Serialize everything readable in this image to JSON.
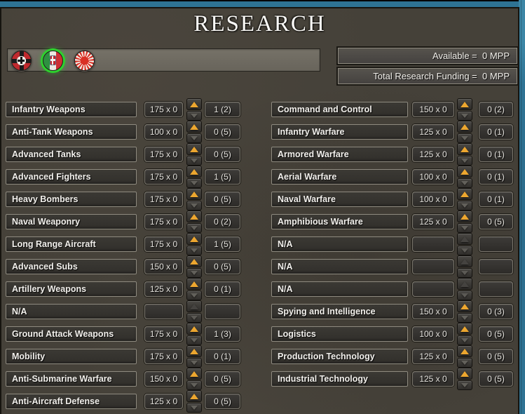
{
  "title": "RESEARCH",
  "colors": {
    "accent_orange": "#eca62f",
    "selected_green": "#2ed12e",
    "map_blue": "#2e7394",
    "panel_brown": "#454139"
  },
  "header": {
    "flags": [
      {
        "name": "germany",
        "selected": false
      },
      {
        "name": "italy",
        "selected": true
      },
      {
        "name": "japan",
        "selected": false
      }
    ],
    "available_text": "Available =  0 MPP",
    "total_funding_text": "Total Research Funding =  0 MPP"
  },
  "columns": {
    "left": [
      {
        "label": "Infantry Weapons",
        "cost": "175 x 0",
        "count": "1 (2)",
        "active": true
      },
      {
        "label": "Anti-Tank Weapons",
        "cost": "100 x 0",
        "count": "0 (5)",
        "active": true
      },
      {
        "label": "Advanced Tanks",
        "cost": "175 x 0",
        "count": "0 (5)",
        "active": true
      },
      {
        "label": "Advanced Fighters",
        "cost": "175 x 0",
        "count": "1 (5)",
        "active": true
      },
      {
        "label": "Heavy Bombers",
        "cost": "175 x 0",
        "count": "0 (5)",
        "active": true
      },
      {
        "label": "Naval Weaponry",
        "cost": "175 x 0",
        "count": "0 (2)",
        "active": true
      },
      {
        "label": "Long Range Aircraft",
        "cost": "175 x 0",
        "count": "1 (5)",
        "active": true
      },
      {
        "label": "Advanced Subs",
        "cost": "150 x 0",
        "count": "0 (5)",
        "active": true
      },
      {
        "label": "Artillery Weapons",
        "cost": "125 x 0",
        "count": "0 (1)",
        "active": true
      },
      {
        "label": "N/A",
        "cost": "",
        "count": "",
        "active": false
      },
      {
        "label": "Ground Attack Weapons",
        "cost": "175 x 0",
        "count": "1 (3)",
        "active": true
      },
      {
        "label": "Mobility",
        "cost": "175 x 0",
        "count": "0 (1)",
        "active": true
      },
      {
        "label": "Anti-Submarine Warfare",
        "cost": "150 x 0",
        "count": "0 (5)",
        "active": true
      },
      {
        "label": "Anti-Aircraft Defense",
        "cost": "125 x 0",
        "count": "0 (5)",
        "active": true
      }
    ],
    "right": [
      {
        "label": "Command and Control",
        "cost": "150 x 0",
        "count": "0 (2)",
        "active": true
      },
      {
        "label": "Infantry Warfare",
        "cost": "125 x 0",
        "count": "0 (1)",
        "active": true
      },
      {
        "label": "Armored Warfare",
        "cost": "125 x 0",
        "count": "0 (1)",
        "active": true
      },
      {
        "label": "Aerial Warfare",
        "cost": "100 x 0",
        "count": "0 (1)",
        "active": true
      },
      {
        "label": "Naval Warfare",
        "cost": "100 x 0",
        "count": "0 (1)",
        "active": true
      },
      {
        "label": "Amphibious Warfare",
        "cost": "125 x 0",
        "count": "0 (5)",
        "active": true
      },
      {
        "label": "N/A",
        "cost": "",
        "count": "",
        "active": false
      },
      {
        "label": "N/A",
        "cost": "",
        "count": "",
        "active": false
      },
      {
        "label": "N/A",
        "cost": "",
        "count": "",
        "active": false
      },
      {
        "label": "Spying and Intelligence",
        "cost": "150 x 0",
        "count": "0 (3)",
        "active": true
      },
      {
        "label": "Logistics",
        "cost": "100 x 0",
        "count": "0 (5)",
        "active": true
      },
      {
        "label": "Production Technology",
        "cost": "125 x 0",
        "count": "0 (5)",
        "active": true
      },
      {
        "label": "Industrial Technology",
        "cost": "125 x 0",
        "count": "0 (5)",
        "active": true
      }
    ]
  }
}
